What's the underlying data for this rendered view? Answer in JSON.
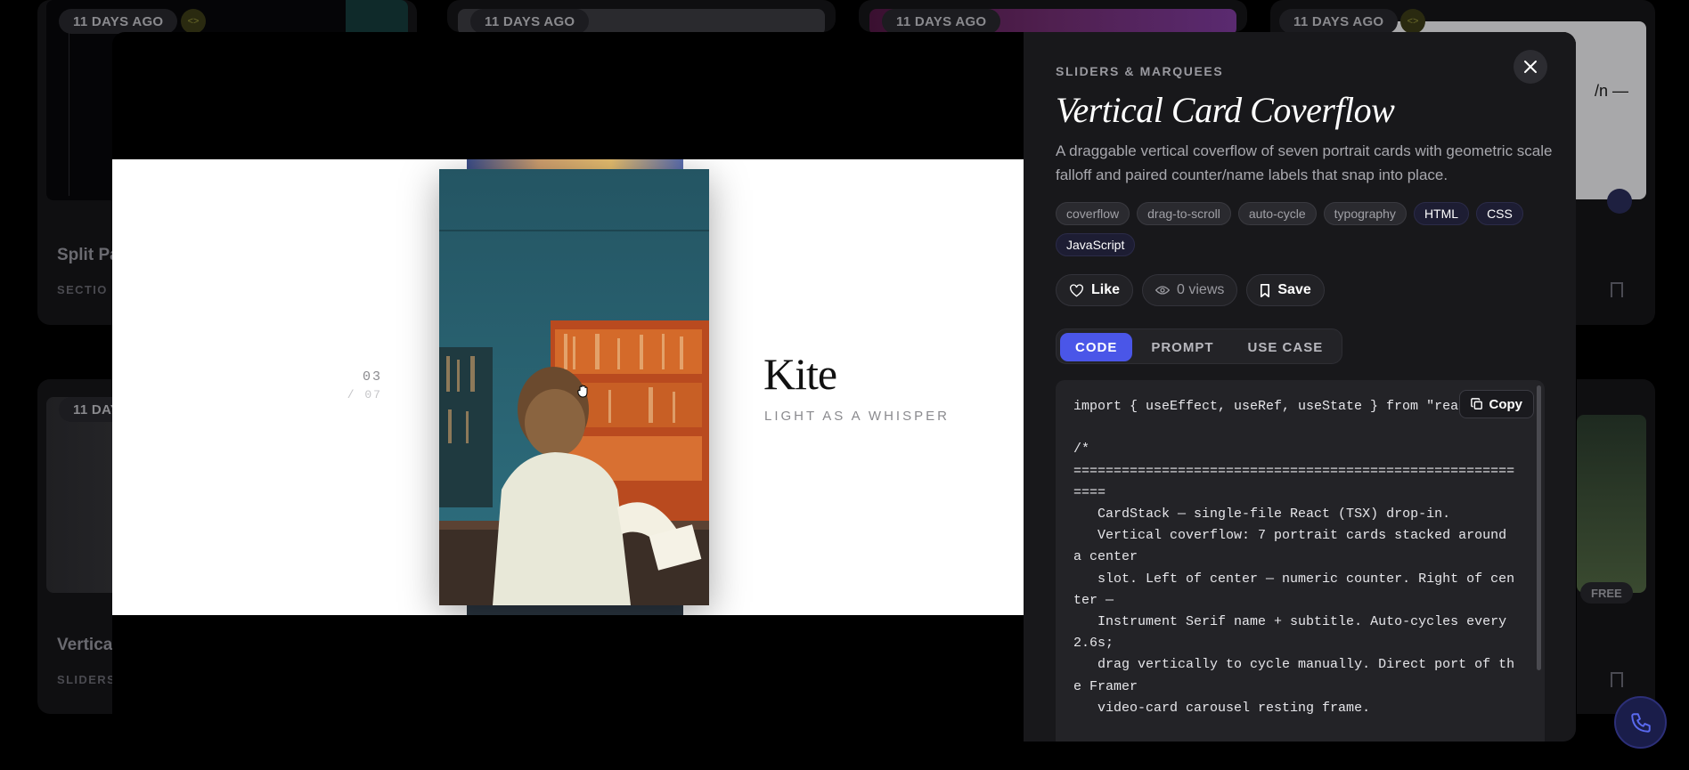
{
  "background": {
    "cards": [
      {
        "age": "11 DAYS AGO",
        "title": "Split Pa",
        "category": "SECTIO"
      },
      {
        "age": "11 DAYS AGO"
      },
      {
        "age": "11 DAYS AGO"
      },
      {
        "age": "11 DAYS AGO",
        "fragment": "/n —"
      },
      {
        "age": "11 DAY",
        "title": "Vertica",
        "category": "SLIDERS"
      },
      {
        "free": "FREE"
      }
    ]
  },
  "preview": {
    "counter": "03",
    "total": "/ 07",
    "name": "Kite",
    "subtitle": "LIGHT AS A WHISPER"
  },
  "panel": {
    "category": "SLIDERS & MARQUEES",
    "title": "Vertical Card Coverflow",
    "description": "A draggable vertical coverflow of seven portrait cards with geometric scale falloff and paired counter/name labels that snap into place.",
    "tags": [
      "coverflow",
      "drag-to-scroll",
      "auto-cycle",
      "typography"
    ],
    "langs": [
      "HTML",
      "CSS",
      "JavaScript"
    ],
    "like_label": "Like",
    "views_label": "0 views",
    "save_label": "Save",
    "tabs": [
      "CODE",
      "PROMPT",
      "USE CASE"
    ],
    "active_tab": "CODE",
    "copy_label": "Copy",
    "code": "import { useEffect, useRef, useState } from \"react\n\n/*\n===========================================================\n   CardStack — single-file React (TSX) drop-in.\n   Vertical coverflow: 7 portrait cards stacked around a center\n   slot. Left of center — numeric counter. Right of center —\n   Instrument Serif name + subtitle. Auto-cycles every 2.6s;\n   drag vertically to cycle manually. Direct port of the Framer\n   video-card carousel resting frame."
  },
  "colors": {
    "accent": "#4a56e8",
    "panel_bg": "#18181b"
  }
}
